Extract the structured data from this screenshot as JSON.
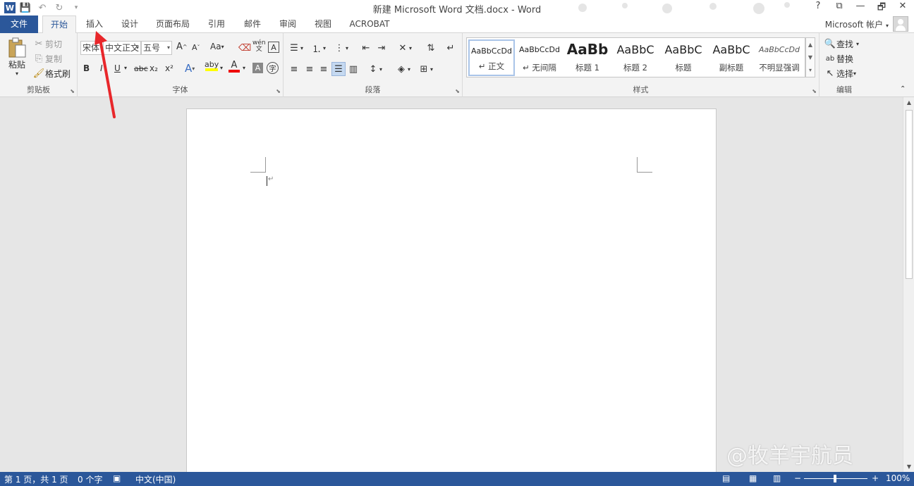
{
  "window": {
    "title": "新建 Microsoft Word 文档.docx - Word",
    "help": "?",
    "controls": [
      "⧉",
      "—",
      "🗗",
      "✕"
    ]
  },
  "qat": {
    "logo": "W",
    "save": "💾",
    "undo": "↶",
    "redo": "↻",
    "customize": "▾"
  },
  "tabs": {
    "file": "文件",
    "home": "开始",
    "insert": "插入",
    "design": "设计",
    "layout": "页面布局",
    "references": "引用",
    "mailings": "邮件",
    "review": "审阅",
    "view": "视图",
    "acrobat": "ACROBAT",
    "account": "Microsoft 帐户"
  },
  "clipboard": {
    "paste": "粘贴",
    "cut": "剪切",
    "copy": "复制",
    "format_painter": "格式刷",
    "label": "剪贴板"
  },
  "font": {
    "latin_font": "宋体",
    "east_asian_font": "中文正文",
    "size": "五号",
    "label": "字体",
    "bold": "B",
    "italic": "I",
    "underline": "U",
    "strike": "abc",
    "subscript": "x₂",
    "superscript": "x²",
    "grow": "A",
    "shrink": "A",
    "change_case": "Aa",
    "phonetic": "wén",
    "highlight": "aby",
    "font_color": "A",
    "char_shading": "A",
    "enclose": "字"
  },
  "paragraph": {
    "label": "段落"
  },
  "styles": {
    "label": "样式",
    "items": [
      {
        "sample": "AaBbCcDd",
        "name": "↵ 正文"
      },
      {
        "sample": "AaBbCcDd",
        "name": "↵ 无间隔"
      },
      {
        "sample": "AaBb",
        "name": "标题 1"
      },
      {
        "sample": "AaBbC",
        "name": "标题 2"
      },
      {
        "sample": "AaBbC",
        "name": "标题"
      },
      {
        "sample": "AaBbC",
        "name": "副标题"
      },
      {
        "sample": "AaBbCcDd",
        "name": "不明显强调"
      }
    ]
  },
  "editing": {
    "label": "编辑",
    "find": "查找",
    "replace": "替换",
    "select": "选择"
  },
  "document": {
    "paragraph_mark": "↵"
  },
  "status": {
    "page": "第 1 页，共 1 页",
    "words": "0 个字",
    "language": "中文(中国)",
    "zoom": "100%",
    "zoom_out": "−",
    "zoom_in": "+"
  },
  "watermark": "@牧羊宇航员",
  "colors": {
    "brand": "#2b579a",
    "annotation": "#e8272b"
  }
}
